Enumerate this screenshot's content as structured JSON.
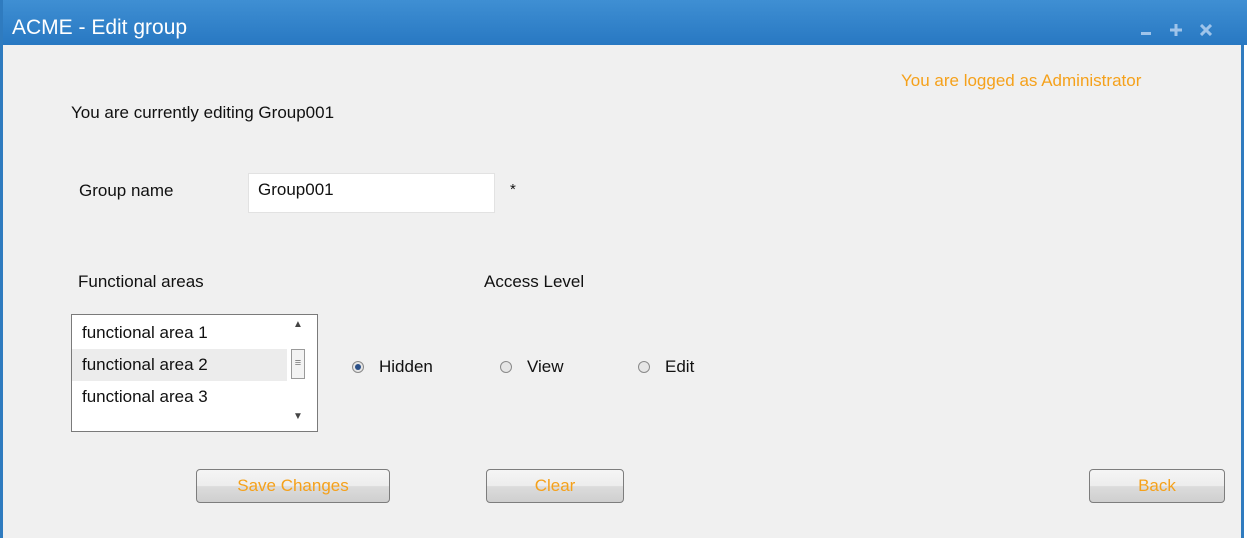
{
  "window": {
    "title": "ACME - Edit group",
    "controls": [
      "minimize-icon",
      "maximize-icon",
      "close-icon"
    ]
  },
  "header": {
    "logged_text": "You are logged as Administrator",
    "editing_text": "You are currently editing Group001"
  },
  "form": {
    "group_name_label": "Group name",
    "group_name_value": "Group001",
    "required_mark": "*",
    "functional_areas_label": "Functional areas",
    "access_level_label": "Access Level",
    "functional_areas": [
      "functional area 1",
      "functional area 2",
      "functional area 3"
    ],
    "selected_area_index": 1,
    "access_levels": [
      "Hidden",
      "View",
      "Edit"
    ],
    "selected_access": "Hidden"
  },
  "buttons": {
    "save": "Save Changes",
    "clear": "Clear",
    "back": "Back"
  },
  "colors": {
    "titlebar": "#2f7bbf",
    "accent_text": "#f5a11b"
  }
}
